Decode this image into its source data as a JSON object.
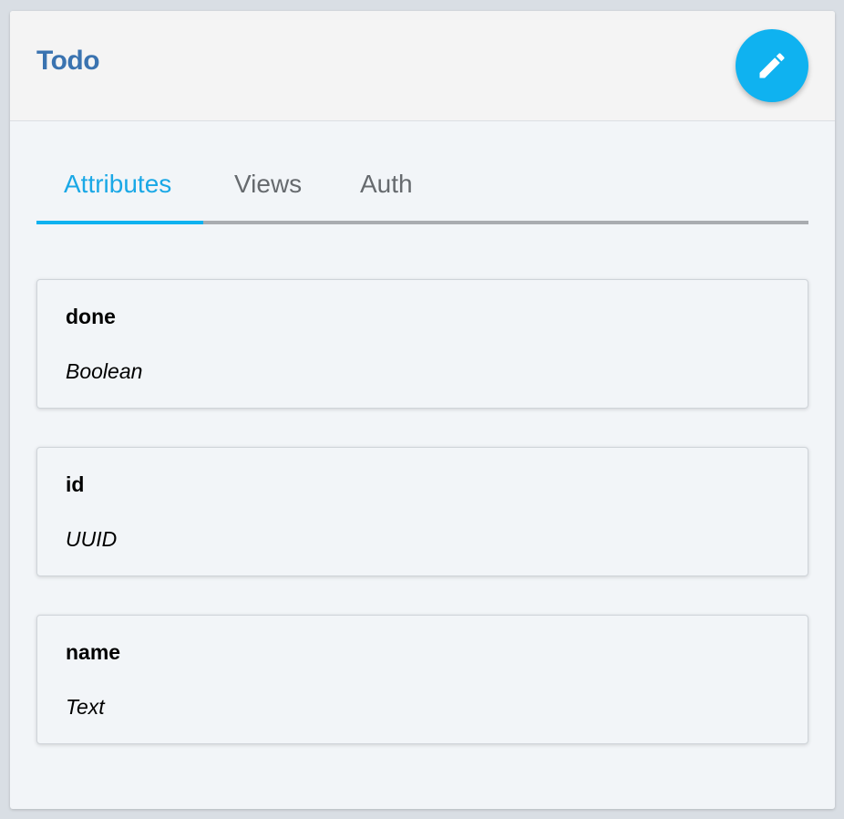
{
  "header": {
    "title": "Todo",
    "edit_icon": "pencil-icon"
  },
  "tabs": [
    {
      "label": "Attributes",
      "active": true
    },
    {
      "label": "Views",
      "active": false
    },
    {
      "label": "Auth",
      "active": false
    }
  ],
  "attributes": [
    {
      "name": "done",
      "type": "Boolean"
    },
    {
      "name": "id",
      "type": "UUID"
    },
    {
      "name": "name",
      "type": "Text"
    }
  ],
  "colors": {
    "accent": "#0fb2f0",
    "title": "#3a73b0",
    "tab_inactive": "#666a6e"
  }
}
